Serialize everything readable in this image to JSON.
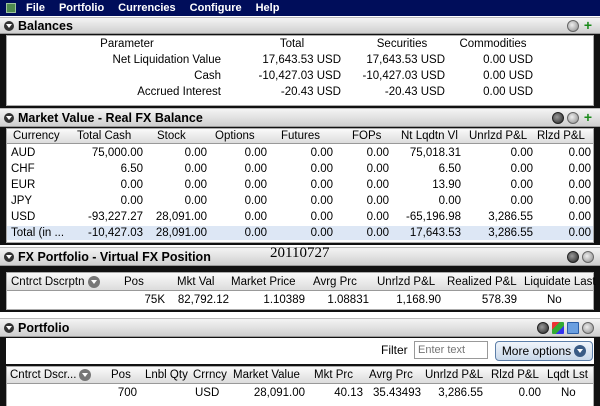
{
  "menu": [
    "File",
    "Portfolio",
    "Currencies",
    "Configure",
    "Help"
  ],
  "balances": {
    "title": "Balances",
    "headers": [
      "Parameter",
      "Total",
      "Securities",
      "Commodities"
    ],
    "rows": [
      [
        "Net Liquidation Value",
        "17,643.53 USD",
        "17,643.53 USD",
        "0.00 USD"
      ],
      [
        "Cash",
        "-10,427.03 USD",
        "-10,427.03 USD",
        "0.00 USD"
      ],
      [
        "Accrued Interest",
        "-20.43 USD",
        "-20.43 USD",
        "0.00 USD"
      ]
    ]
  },
  "market_value": {
    "title": "Market Value - Real FX Balance",
    "headers": [
      "Currency",
      "Total Cash",
      "Stock",
      "Options",
      "Futures",
      "FOPs",
      "Nt Lqdtn Vl",
      "Unrlzd P&L",
      "Rlzd P&L"
    ],
    "rows": [
      [
        "AUD",
        "75,000.00",
        "0.00",
        "0.00",
        "0.00",
        "0.00",
        "75,018.31",
        "0.00",
        "0.00"
      ],
      [
        "CHF",
        "6.50",
        "0.00",
        "0.00",
        "0.00",
        "0.00",
        "6.50",
        "0.00",
        "0.00"
      ],
      [
        "EUR",
        "0.00",
        "0.00",
        "0.00",
        "0.00",
        "0.00",
        "13.90",
        "0.00",
        "0.00"
      ],
      [
        "JPY",
        "0.00",
        "0.00",
        "0.00",
        "0.00",
        "0.00",
        "0.00",
        "0.00",
        "0.00"
      ],
      [
        "USD",
        "-93,227.27",
        "28,091.00",
        "0.00",
        "0.00",
        "0.00",
        "-65,196.98",
        "3,286.55",
        "0.00"
      ],
      [
        "Total (in ...",
        "-10,427.03",
        "28,091.00",
        "0.00",
        "0.00",
        "0.00",
        "17,643.53",
        "3,286.55",
        "0.00"
      ]
    ]
  },
  "date_stamp": "20110727",
  "fx_portfolio": {
    "title": "FX Portfolio - Virtual FX Position",
    "headers": [
      "Cntrct Dscrptn",
      "Pos",
      "Mkt Val",
      "Market Price",
      "Avrg Prc",
      "Unrlzd P&L",
      "Realized P&L",
      "Liquidate Last"
    ],
    "row": [
      "",
      "75K",
      "82,792.12",
      "1.10389",
      "1.08831",
      "1,168.90",
      "578.39",
      "No"
    ]
  },
  "portfolio": {
    "title": "Portfolio",
    "filter_label": "Filter",
    "filter_placeholder": "Enter text",
    "more_options": "More options",
    "headers": [
      "Cntrct Dscr...",
      "Pos",
      "Lnbl Qty",
      "Crrncy",
      "Market Value",
      "Mkt Prc",
      "Avrg Prc",
      "Unrlzd P&L",
      "Rlzd P&L",
      "Lqdt Lst"
    ],
    "row": [
      "",
      "700",
      "",
      "USD",
      "28,091.00",
      "40.13",
      "35.43493",
      "3,286.55",
      "0.00",
      "No"
    ]
  },
  "colors": {
    "menubar": "#000d5a",
    "accent_plus": "#1a8a1a",
    "selected_row": "#dde7f5"
  }
}
